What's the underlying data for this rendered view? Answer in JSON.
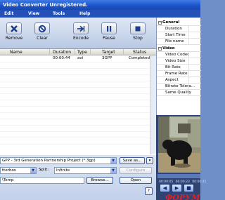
{
  "window": {
    "title": "Video Converter Unregistered."
  },
  "menu": [
    {
      "label": "Edit",
      "key": "E"
    },
    {
      "label": "View",
      "key": "V"
    },
    {
      "label": "Tools",
      "key": "T"
    },
    {
      "label": "Help",
      "key": "H"
    }
  ],
  "toolbar": {
    "remove": "Remove",
    "clear": "Clear",
    "encode": "Encode",
    "pause": "Pause",
    "stop": "Stop"
  },
  "file_list": {
    "columns": [
      "Name",
      "Duration",
      "Type",
      "Target",
      "Status"
    ],
    "rows": [
      {
        "name": "",
        "duration": "00:00:44",
        "type": "avi",
        "target": "3GPP",
        "status": "Completed"
      }
    ]
  },
  "output": {
    "format_value": "GPP - 3rd Generation Partnership Project  (*.3gp)",
    "save_as_label": "Save as...",
    "profile_value": "tterbox",
    "split_label": "Split:",
    "split_value": "Infinite",
    "configure_label": "Configure",
    "folder_value": "\\Temp",
    "browse_label": "Browse...",
    "open_label": "Open"
  },
  "properties": {
    "sections": [
      {
        "title": "General",
        "items": [
          "Duration",
          "Start Time",
          "File name"
        ]
      },
      {
        "title": "Video",
        "items": [
          "Video Codec",
          "Video Size",
          "Bit Rate",
          "Frame Rate",
          "Aspect",
          "Bitrate Tolera...",
          "Same Quality"
        ]
      }
    ]
  },
  "preview": {
    "tick_labels": [
      "00:00:05",
      "00:00:23",
      "00:00:41"
    ],
    "watermark": "ФОРУМ"
  },
  "colors": {
    "accent": "#2451b8",
    "watermark": "#e0202a"
  }
}
